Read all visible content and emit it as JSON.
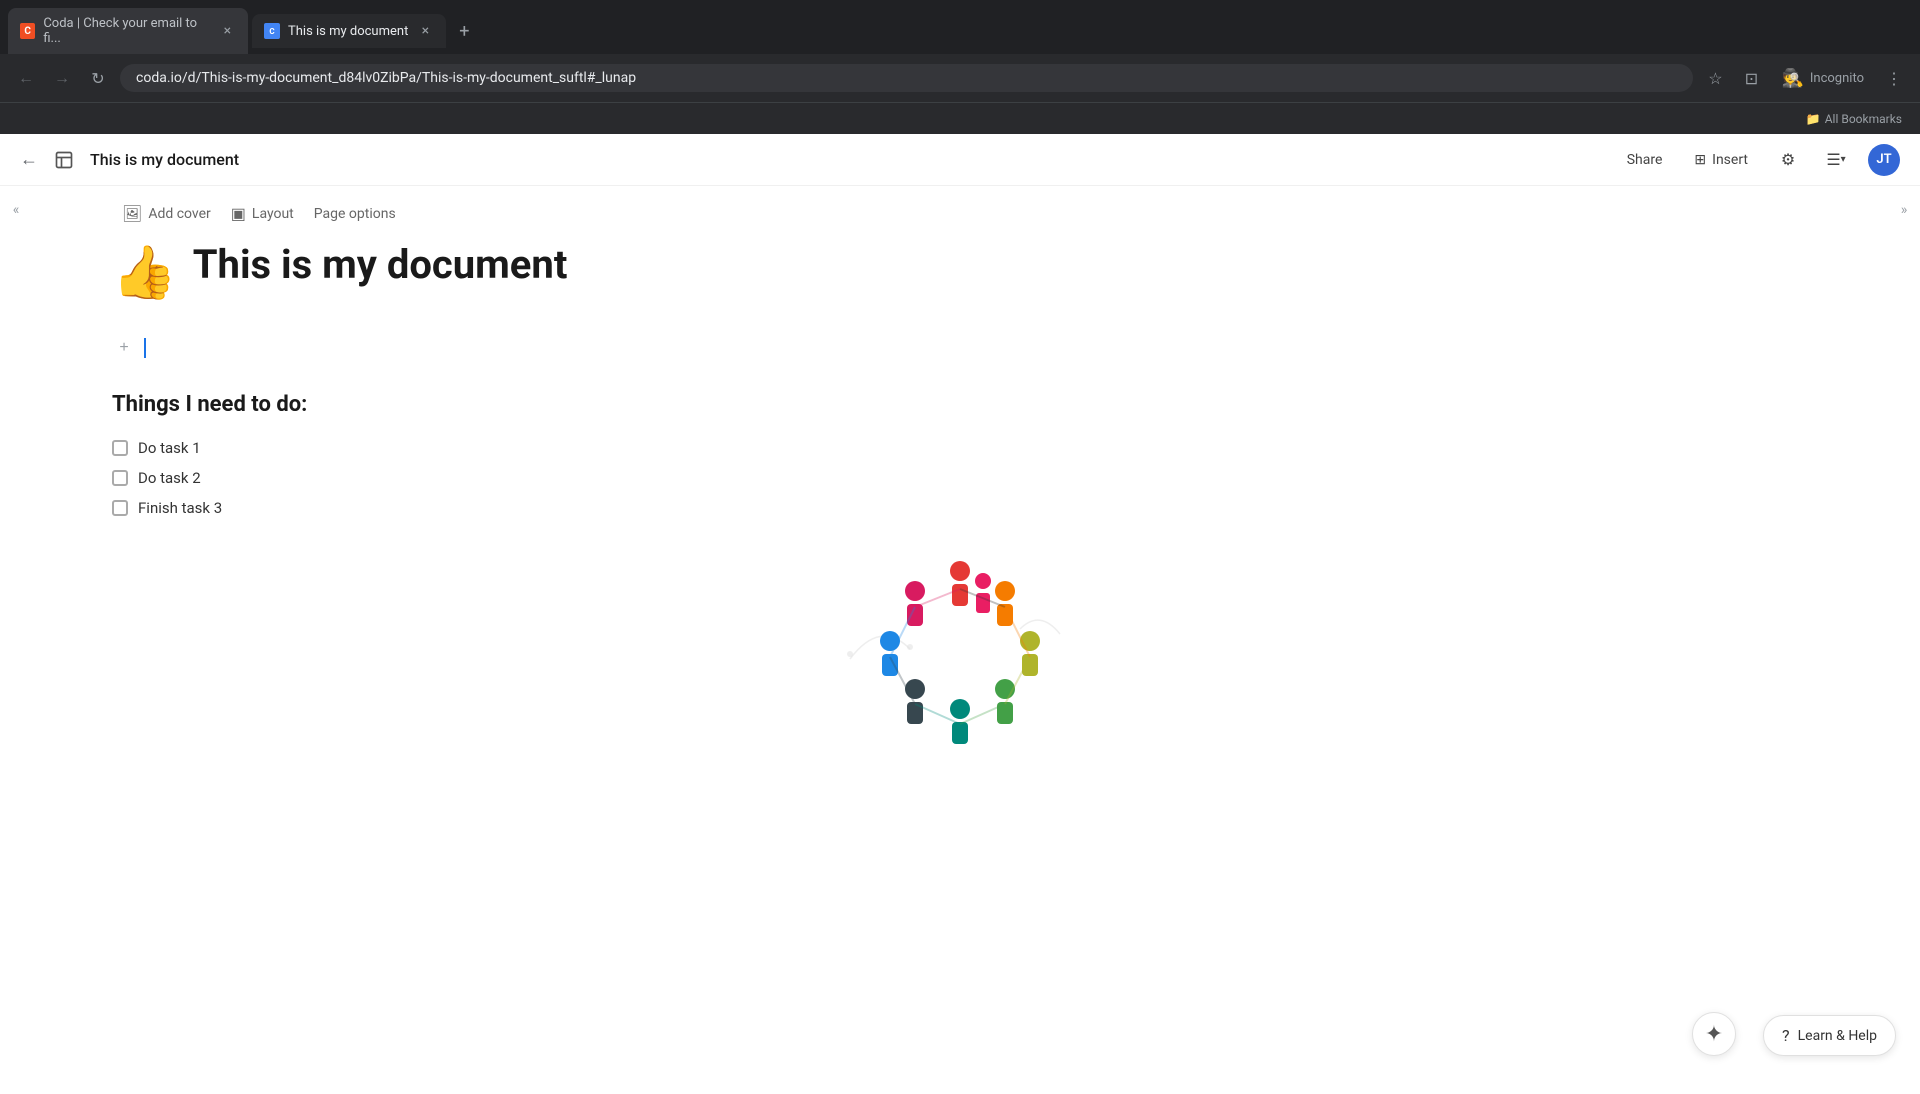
{
  "browser": {
    "tabs": [
      {
        "id": "tab-coda-email",
        "favicon_type": "coda",
        "label": "Coda | Check your email to fi...",
        "active": false
      },
      {
        "id": "tab-my-doc",
        "favicon_type": "coda-active",
        "label": "This is my document",
        "active": true
      }
    ],
    "new_tab_icon": "+",
    "url": "coda.io/d/This-is-my-document_d84lv0ZibPa/This-is-my-document_suftl#_lunap",
    "back_btn": "←",
    "forward_btn": "→",
    "reload_btn": "↻",
    "bookmark_icon": "☆",
    "profile_icon": "⊡",
    "incognito_label": "Incognito",
    "more_icon": "⋮",
    "bookmarks_label": "All Bookmarks"
  },
  "app_header": {
    "back_icon": "←",
    "doc_title": "This is my document",
    "share_label": "Share",
    "insert_label": "Insert",
    "settings_icon": "⚙",
    "view_icon": "☰",
    "avatar_initials": "JT",
    "avatar_color": "#3367d6"
  },
  "sidebar": {
    "toggle_icon": "«"
  },
  "right_panel": {
    "toggle_icon": "»"
  },
  "toolbar": {
    "add_cover_icon": "🖼",
    "add_cover_label": "Add cover",
    "layout_icon": "⬛",
    "layout_label": "Layout",
    "page_options_label": "Page options"
  },
  "document": {
    "emoji": "👍",
    "title": "This is my document",
    "section_heading": "Things I need to do:",
    "checklist_items": [
      {
        "id": "task-1",
        "label": "Do task 1",
        "checked": false
      },
      {
        "id": "task-2",
        "label": "Do task 2",
        "checked": false
      },
      {
        "id": "task-3",
        "label": "Finish task 3",
        "checked": false
      }
    ]
  },
  "bottom_bar": {
    "sparkle_icon": "✦",
    "learn_help_icon": "?",
    "learn_help_label": "Learn & Help"
  }
}
